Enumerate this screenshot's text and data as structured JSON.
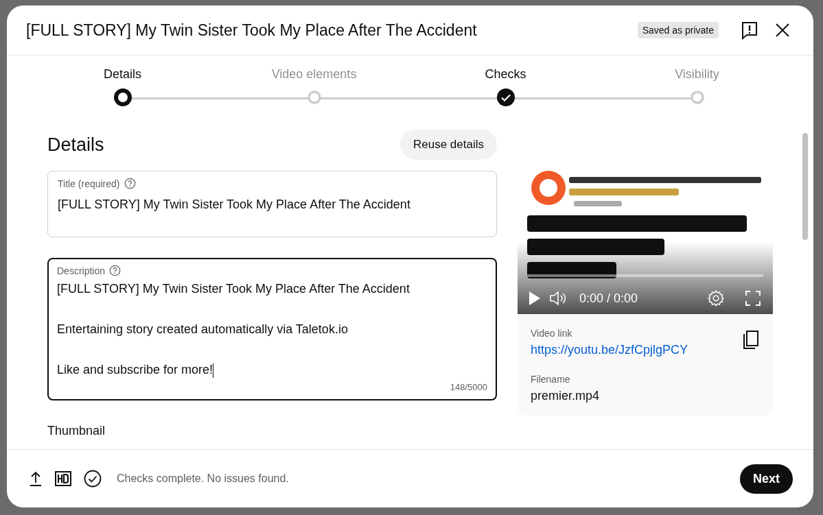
{
  "dialog": {
    "title": "[FULL STORY] My Twin Sister Took My Place After The Accident",
    "save_badge": "Saved as private"
  },
  "steps": [
    {
      "label": "Details",
      "selected": true,
      "completed": false
    },
    {
      "label": "Video elements",
      "selected": false,
      "completed": false
    },
    {
      "label": "Checks",
      "selected": false,
      "completed": true
    },
    {
      "label": "Visibility",
      "selected": false,
      "completed": false
    }
  ],
  "details": {
    "heading": "Details",
    "reuse_button": "Reuse details",
    "title_field": {
      "label": "Title (required)",
      "value": "[FULL STORY] My Twin Sister Took My Place After The Accident"
    },
    "description_field": {
      "label": "Description",
      "value": "[FULL STORY] My Twin Sister Took My Place After The Accident\n\nEntertaining story created automatically via Taletok.io\n\nLike and subscribe for more!",
      "focused": true,
      "counter": "148/5000"
    },
    "thumbnail_heading": "Thumbnail"
  },
  "preview": {
    "player": {
      "kind": "picture",
      "level": 0,
      "time": "0:00 / 0:00"
    },
    "video_link_label": "Video link",
    "video_link": "https://youtu.be/JzfCpjlgPCY",
    "filename_label": "Filename",
    "filename": "premier.mp4"
  },
  "footer": {
    "status": "Checks complete. No issues found.",
    "next_button": "Next"
  }
}
